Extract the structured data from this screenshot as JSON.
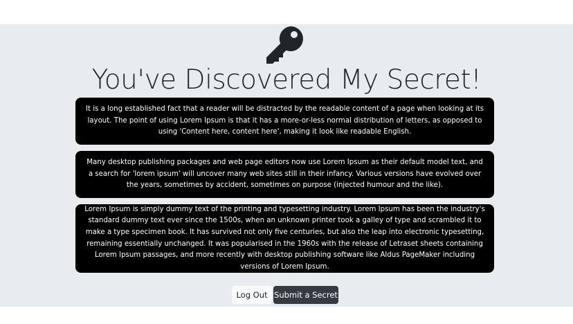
{
  "header": {
    "title": "You've Discovered My Secret!",
    "icon": "key-icon"
  },
  "secrets": [
    {
      "text": "It is a long established fact that a reader will be distracted by the readable content of a page when looking at its layout. The point of using Lorem Ipsum is that it has a more-or-less normal distribution of letters, as opposed to using 'Content here, content here', making it look like readable English."
    },
    {
      "text": "Many desktop publishing packages and web page editors now use Lorem Ipsum as their default model text, and a search for 'lorem ipsum' will uncover many web sites still in their infancy. Various versions have evolved over the years, sometimes by accident, sometimes on purpose (injected humour and the like)."
    },
    {
      "text": "Lorem Ipsum is simply dummy text of the printing and typesetting industry. Lorem Ipsum has been the industry's standard dummy text ever since the 1500s, when an unknown printer took a galley of type and scrambled it to make a type specimen book. It has survived not only five centuries, but also the leap into electronic typesetting, remaining essentially unchanged. It was popularised in the 1960s with the release of Letraset sheets containing Lorem Ipsum passages, and more recently with desktop publishing software like Aldus PageMaker including versions of Lorem Ipsum."
    }
  ],
  "actions": {
    "logout_label": "Log Out",
    "submit_label": "Submit a Secret"
  },
  "colors": {
    "background": "#e9ecef",
    "card": "#000000",
    "card_text": "#ffffff",
    "button_dark": "#343a40",
    "button_light": "#f8f9fa"
  }
}
